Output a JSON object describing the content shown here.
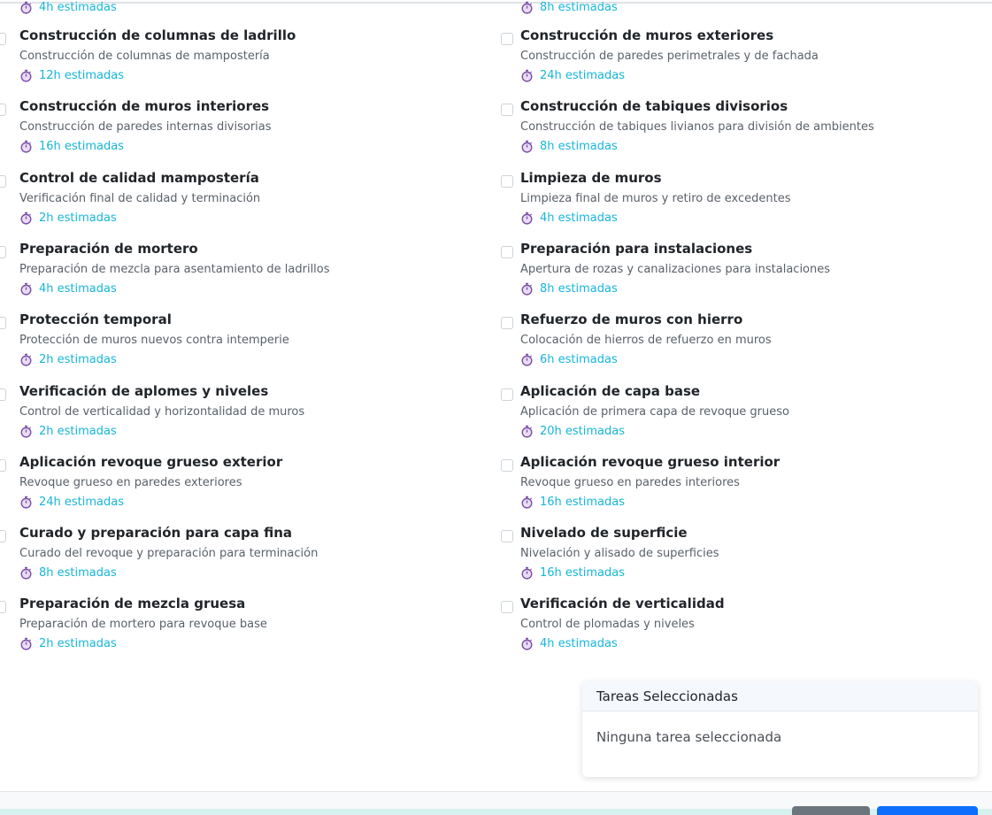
{
  "partial_top": {
    "left_hours": "4h estimadas",
    "right_hours": "8h estimadas"
  },
  "tasks": [
    {
      "title": "Construcción de columnas de ladrillo",
      "desc": "Construcción de columnas de mampostería",
      "hours": "12h estimadas"
    },
    {
      "title": "Construcción de muros exteriores",
      "desc": "Construcción de paredes perimetrales y de fachada",
      "hours": "24h estimadas"
    },
    {
      "title": "Construcción de muros interiores",
      "desc": "Construcción de paredes internas divisorias",
      "hours": "16h estimadas"
    },
    {
      "title": "Construcción de tabiques divisorios",
      "desc": "Construcción de tabiques livianos para división de ambientes",
      "hours": "8h estimadas"
    },
    {
      "title": "Control de calidad mampostería",
      "desc": "Verificación final de calidad y terminación",
      "hours": "2h estimadas"
    },
    {
      "title": "Limpieza de muros",
      "desc": "Limpieza final de muros y retiro de excedentes",
      "hours": "4h estimadas"
    },
    {
      "title": "Preparación de mortero",
      "desc": "Preparación de mezcla para asentamiento de ladrillos",
      "hours": "4h estimadas"
    },
    {
      "title": "Preparación para instalaciones",
      "desc": "Apertura de rozas y canalizaciones para instalaciones",
      "hours": "8h estimadas"
    },
    {
      "title": "Protección temporal",
      "desc": "Protección de muros nuevos contra intemperie",
      "hours": "2h estimadas"
    },
    {
      "title": "Refuerzo de muros con hierro",
      "desc": "Colocación de hierros de refuerzo en muros",
      "hours": "6h estimadas"
    },
    {
      "title": "Verificación de aplomes y niveles",
      "desc": "Control de verticalidad y horizontalidad de muros",
      "hours": "2h estimadas"
    },
    {
      "title": "Aplicación de capa base",
      "desc": "Aplicación de primera capa de revoque grueso",
      "hours": "20h estimadas"
    },
    {
      "title": "Aplicación revoque grueso exterior",
      "desc": "Revoque grueso en paredes exteriores",
      "hours": "24h estimadas"
    },
    {
      "title": "Aplicación revoque grueso interior",
      "desc": "Revoque grueso en paredes interiores",
      "hours": "16h estimadas"
    },
    {
      "title": "Curado y preparación para capa fina",
      "desc": "Curado del revoque y preparación para terminación",
      "hours": "8h estimadas"
    },
    {
      "title": "Nivelado de superficie",
      "desc": "Nivelación y alisado de superficies",
      "hours": "16h estimadas"
    },
    {
      "title": "Preparación de mezcla gruesa",
      "desc": "Preparación de mortero para revoque base",
      "hours": "2h estimadas"
    },
    {
      "title": "Verificación de verticalidad",
      "desc": "Control de plomadas y niveles",
      "hours": "4h estimadas"
    }
  ],
  "selected_panel": {
    "header": "Tareas Seleccionadas",
    "empty_text": "Ninguna tarea seleccionada"
  },
  "icons": {
    "hours_icon": "stopwatch-icon"
  },
  "colors": {
    "accent": "#17b6d8",
    "stopwatch": "#7b4fa6"
  }
}
